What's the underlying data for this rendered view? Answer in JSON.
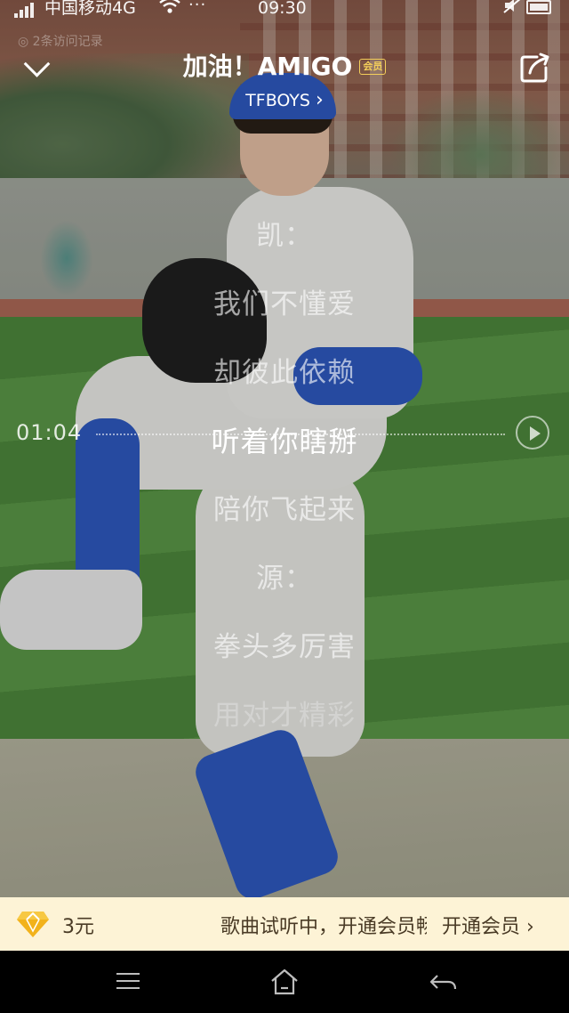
{
  "status_bar": {
    "carrier": "中国移动4G",
    "dots": "···",
    "time": "09:30",
    "notice": "◎ 2条访问记录"
  },
  "header": {
    "title": "加油！AMIGO",
    "vip_badge": "会员",
    "artist": "TFBOYS",
    "artist_chevron": "›"
  },
  "lyrics": [
    {
      "text": "凯：",
      "state": "normal"
    },
    {
      "text": "我们不懂爱",
      "state": "normal"
    },
    {
      "text": "却彼此依赖",
      "state": "normal"
    },
    {
      "text": "听着你瞎掰",
      "state": "active"
    },
    {
      "text": "陪你飞起来",
      "state": "normal"
    },
    {
      "text": "源：",
      "state": "normal"
    },
    {
      "text": "拳头多厉害",
      "state": "normal"
    },
    {
      "text": "用对才精彩",
      "state": "fade"
    }
  ],
  "timeline": {
    "time": "01:04"
  },
  "promo": {
    "price": "3元",
    "message": "歌曲试听中，开通会员畅听",
    "cta": "开通会员 ›"
  },
  "colors": {
    "promo_bg": "#fdf3d6",
    "vip_gold": "#f4cf5a",
    "diamond": "#f2b21b"
  },
  "icons": {
    "collapse": "chevron-down-icon",
    "share": "share-icon",
    "play_line": "play-circle-icon",
    "diamond": "diamond-icon",
    "menu": "menu-icon",
    "home": "home-icon",
    "back": "back-icon"
  }
}
